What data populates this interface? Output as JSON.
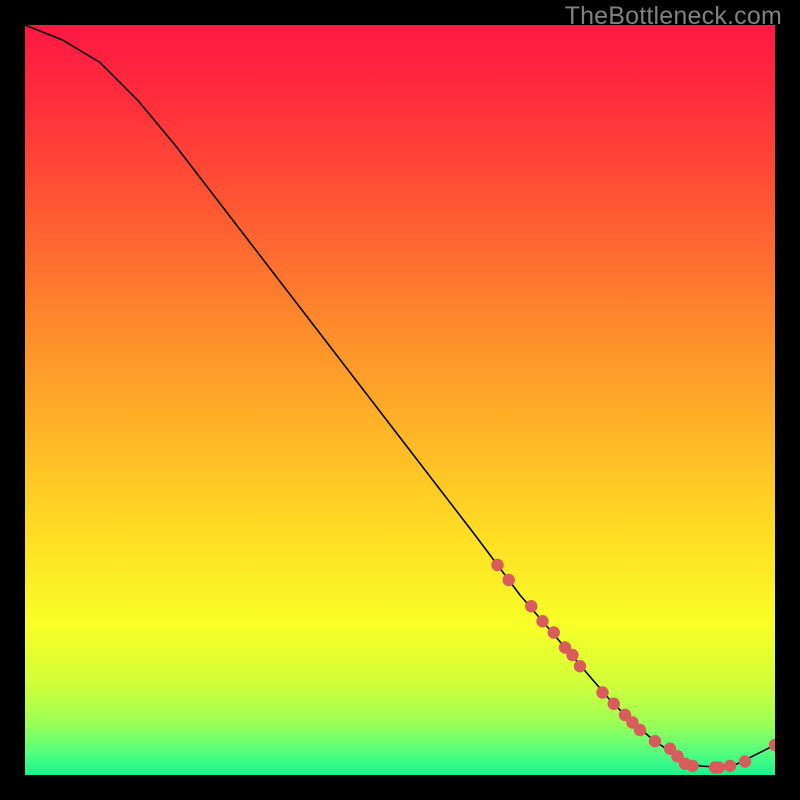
{
  "watermark": "TheBottleneck.com",
  "chart_data": {
    "type": "line",
    "title": "",
    "xlabel": "",
    "ylabel": "",
    "xlim": [
      0,
      100
    ],
    "ylim": [
      0,
      100
    ],
    "series": [
      {
        "name": "curve",
        "x": [
          0,
          5,
          10,
          15,
          20,
          25,
          30,
          35,
          40,
          45,
          50,
          55,
          60,
          63,
          66,
          69,
          72,
          75,
          78,
          81,
          84,
          87,
          90,
          93,
          95,
          100
        ],
        "y": [
          100,
          98,
          95,
          90,
          84,
          77.5,
          71,
          64.5,
          58,
          51.5,
          45,
          38.5,
          32,
          28,
          24,
          20.5,
          17,
          13.5,
          10,
          7,
          4.5,
          2.5,
          1.2,
          1,
          1.5,
          4
        ]
      }
    ],
    "scatter": [
      {
        "name": "dots",
        "x": [
          63,
          64.5,
          67.5,
          69,
          70.5,
          72,
          73,
          74,
          77,
          78.5,
          80,
          81,
          82,
          84,
          86,
          87,
          88,
          89,
          92,
          92.5,
          94,
          96,
          100
        ],
        "y": [
          28,
          26,
          22.5,
          20.5,
          19,
          17,
          16,
          14.5,
          11,
          9.5,
          8,
          7,
          6,
          4.5,
          3.5,
          2.5,
          1.5,
          1.2,
          1,
          1,
          1.2,
          1.8,
          4
        ]
      }
    ],
    "gradient_stops": [
      {
        "offset": 0.0,
        "color": "#ff1943"
      },
      {
        "offset": 0.1,
        "color": "#ff2d3c"
      },
      {
        "offset": 0.25,
        "color": "#ff5a32"
      },
      {
        "offset": 0.4,
        "color": "#ff8a2c"
      },
      {
        "offset": 0.55,
        "color": "#ffb726"
      },
      {
        "offset": 0.7,
        "color": "#ffe324"
      },
      {
        "offset": 0.8,
        "color": "#f8ff27"
      },
      {
        "offset": 0.88,
        "color": "#d0ff3a"
      },
      {
        "offset": 0.93,
        "color": "#9dff55"
      },
      {
        "offset": 0.97,
        "color": "#55ff7e"
      },
      {
        "offset": 1.0,
        "color": "#17f38f"
      }
    ],
    "dot_color": "#d85c5c",
    "line_color": "#000000"
  }
}
